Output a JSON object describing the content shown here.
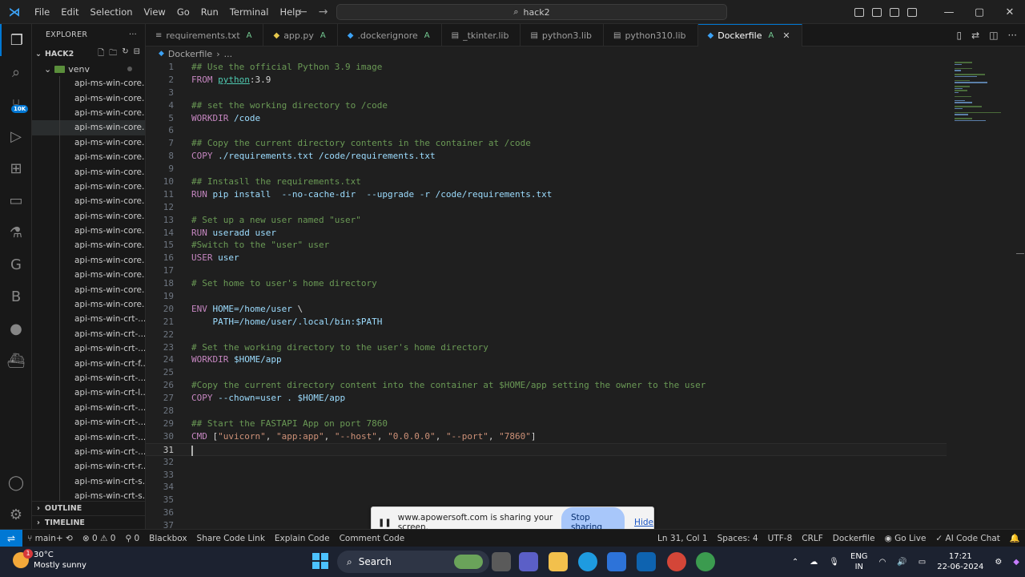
{
  "titlebar": {
    "menu": [
      "File",
      "Edit",
      "Selection",
      "View",
      "Go",
      "Run",
      "Terminal",
      "Help"
    ],
    "search_text": "hack2"
  },
  "sidebar": {
    "header": "EXPLORER",
    "project": "HACK2",
    "folder": "venv",
    "items": [
      "api-ms-win-core...",
      "api-ms-win-core...",
      "api-ms-win-core...",
      "api-ms-win-core...",
      "api-ms-win-core...",
      "api-ms-win-core...",
      "api-ms-win-core...",
      "api-ms-win-core...",
      "api-ms-win-core...",
      "api-ms-win-core...",
      "api-ms-win-core...",
      "api-ms-win-core...",
      "api-ms-win-core...",
      "api-ms-win-core...",
      "api-ms-win-core...",
      "api-ms-win-core...",
      "api-ms-win-crt-...",
      "api-ms-win-crt-...",
      "api-ms-win-crt-...",
      "api-ms-win-crt-f...",
      "api-ms-win-crt-...",
      "api-ms-win-crt-l...",
      "api-ms-win-crt-...",
      "api-ms-win-crt-...",
      "api-ms-win-crt-...",
      "api-ms-win-crt-...",
      "api-ms-win-crt-r...",
      "api-ms-win-crt-s...",
      "api-ms-win-crt-s..."
    ],
    "outline": "OUTLINE",
    "timeline": "TIMELINE",
    "badge": "10K"
  },
  "tabs": [
    {
      "label": "requirements.txt",
      "mod": "A",
      "icon": "≡",
      "color": "#a9a9a9"
    },
    {
      "label": "app.py",
      "mod": "A",
      "icon": "◆",
      "color": "#e6c74c"
    },
    {
      "label": ".dockerignore",
      "mod": "A",
      "icon": "◆",
      "color": "#3ca2f5"
    },
    {
      "label": "_tkinter.lib",
      "mod": "",
      "icon": "▤",
      "color": "#a9a9a9"
    },
    {
      "label": "python3.lib",
      "mod": "",
      "icon": "▤",
      "color": "#a9a9a9"
    },
    {
      "label": "python310.lib",
      "mod": "",
      "icon": "▤",
      "color": "#a9a9a9"
    },
    {
      "label": "Dockerfile",
      "mod": "A",
      "icon": "◆",
      "color": "#3ca2f5",
      "active": true
    }
  ],
  "breadcrumb": {
    "file": "Dockerfile",
    "rest": "..."
  },
  "editor": {
    "current_line": 31,
    "lines": [
      [
        [
          "c-comment",
          "## Use the official Python 3.9 image"
        ]
      ],
      [
        [
          "c-kw",
          "FROM "
        ],
        [
          "c-ul",
          "python"
        ],
        [
          "c-plain",
          ":3.9"
        ]
      ],
      [],
      [
        [
          "c-comment",
          "## set the working directory to /code"
        ]
      ],
      [
        [
          "c-kw",
          "WORKDIR "
        ],
        [
          "c-txt",
          "/code"
        ]
      ],
      [],
      [
        [
          "c-comment",
          "## Copy the current directory contents in the container at /code"
        ]
      ],
      [
        [
          "c-kw",
          "COPY "
        ],
        [
          "c-txt",
          "./requirements.txt /code/requirements.txt"
        ]
      ],
      [],
      [
        [
          "c-comment",
          "## Instasll the requirements.txt"
        ]
      ],
      [
        [
          "c-kw",
          "RUN "
        ],
        [
          "c-txt",
          "pip install  --no-cache-dir  --upgrade -r /code/requirements.txt"
        ]
      ],
      [],
      [
        [
          "c-comment",
          "# Set up a new user named \"user\""
        ]
      ],
      [
        [
          "c-kw",
          "RUN "
        ],
        [
          "c-txt",
          "useradd user"
        ]
      ],
      [
        [
          "c-comment",
          "#Switch to the \"user\" user"
        ]
      ],
      [
        [
          "c-kw",
          "USER "
        ],
        [
          "c-txt",
          "user"
        ]
      ],
      [],
      [
        [
          "c-comment",
          "# Set home to user's home directory"
        ]
      ],
      [],
      [
        [
          "c-kw",
          "ENV "
        ],
        [
          "c-txt",
          "HOME=/home/user "
        ],
        [
          "c-plain",
          "\\"
        ]
      ],
      [
        [
          "c-txt",
          "    PATH=/home/user/.local/bin:$PATH"
        ]
      ],
      [],
      [
        [
          "c-comment",
          "# Set the working directory to the user's home directory"
        ]
      ],
      [
        [
          "c-kw",
          "WORKDIR "
        ],
        [
          "c-txt",
          "$HOME/app"
        ]
      ],
      [],
      [
        [
          "c-comment",
          "#Copy the current directory content into the container at $HOME/app setting the owner to the user"
        ]
      ],
      [
        [
          "c-kw",
          "COPY "
        ],
        [
          "c-txt",
          "--chown=user . $HOME/app"
        ]
      ],
      [],
      [
        [
          "c-comment",
          "## Start the FASTAPI App on port 7860"
        ]
      ],
      [
        [
          "c-kw",
          "CMD "
        ],
        [
          "c-plain",
          "["
        ],
        [
          "c-str",
          "\"uvicorn\""
        ],
        [
          "c-plain",
          ", "
        ],
        [
          "c-str",
          "\"app:app\""
        ],
        [
          "c-plain",
          ", "
        ],
        [
          "c-str",
          "\"--host\""
        ],
        [
          "c-plain",
          ", "
        ],
        [
          "c-str",
          "\"0.0.0.0\""
        ],
        [
          "c-plain",
          ", "
        ],
        [
          "c-str",
          "\"--port\""
        ],
        [
          "c-plain",
          ", "
        ],
        [
          "c-str",
          "\"7860\""
        ],
        [
          "c-plain",
          "]"
        ]
      ],
      [],
      [],
      [],
      [],
      [],
      [],
      []
    ]
  },
  "share": {
    "text": "www.apowersoft.com is sharing your screen.",
    "stop": "Stop sharing",
    "hide": "Hide"
  },
  "status": {
    "branch": "main+",
    "problems": "0",
    "warnings": "0",
    "ports": "0",
    "left_items": [
      "Blackbox",
      "Share Code Link",
      "Explain Code",
      "Comment Code"
    ],
    "position": "Ln 31, Col 1",
    "spaces": "Spaces: 4",
    "encoding": "UTF-8",
    "eol": "CRLF",
    "language": "Dockerfile",
    "golive": "Go Live",
    "ai": "AI Code Chat"
  },
  "taskbar": {
    "temp": "30°C",
    "weather": "Mostly sunny",
    "weather_badge": "1",
    "search": "Search",
    "lang1": "ENG",
    "lang2": "IN",
    "time": "17:21",
    "date": "22-06-2024"
  }
}
